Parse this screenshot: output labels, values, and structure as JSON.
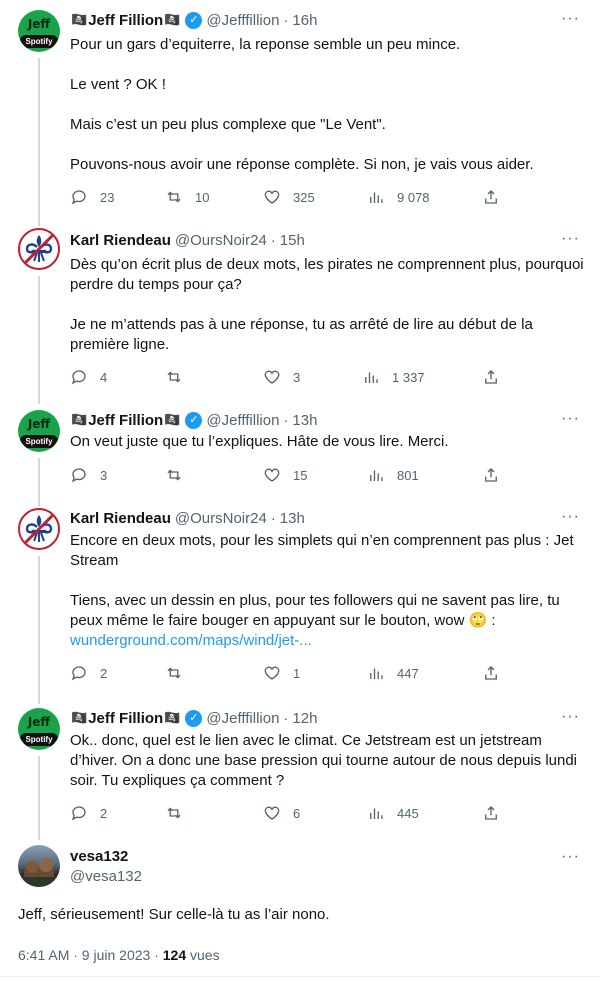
{
  "tweets": [
    {
      "author": "Jeff Fillion",
      "handle": "@Jefffillion",
      "time": "16h",
      "paragraphs": [
        "Pour un gars d’equiterre, la reponse semble un peu mince.",
        "Le vent ? OK !",
        "Mais c’est un peu plus complexe que \"Le Vent\".",
        "Pouvons-nous avoir une réponse complète. Si non, je vais vous aider."
      ],
      "replies": "23",
      "retweets": "10",
      "likes": "325",
      "views": "9 078"
    },
    {
      "author": "Karl Riendeau",
      "handle": "@OursNoir24",
      "time": "15h",
      "paragraphs": [
        "Dès qu’on écrit plus de deux mots, les pirates ne comprennent plus, pourquoi perdre du temps pour ça?",
        "Je ne m’attends pas à une réponse, tu as arrêté de lire au début de la première ligne."
      ],
      "replies": "4",
      "retweets": "",
      "likes": "3",
      "views": "1 337"
    },
    {
      "author": "Jeff Fillion",
      "handle": "@Jefffillion",
      "time": "13h",
      "paragraphs": [
        "On veut juste que tu l’expliques. Hâte de vous lire. Merci."
      ],
      "replies": "3",
      "retweets": "",
      "likes": "15",
      "views": "801"
    },
    {
      "author": "Karl Riendeau",
      "handle": "@OursNoir24",
      "time": "13h",
      "paragraphs": [
        "Encore en deux mots, pour les simplets qui n’en comprennent pas plus : Jet Stream",
        "Tiens, avec un dessin en plus, pour tes followers qui ne savent pas lire, tu peux même le faire bouger en appuyant sur le bouton, wow 🙄 :"
      ],
      "link": "wunderground.com/maps/wind/jet-...",
      "replies": "2",
      "retweets": "",
      "likes": "1",
      "views": "447"
    },
    {
      "author": "Jeff Fillion",
      "handle": "@Jefffillion",
      "time": "12h",
      "paragraphs": [
        "Ok.. donc, quel est le lien avec le climat. Ce Jetstream est un jetstream d’hiver. On a donc une base pression qui tourne autour de nous depuis lundi soir. Tu expliques ça comment ?"
      ],
      "replies": "2",
      "retweets": "",
      "likes": "6",
      "views": "445"
    }
  ],
  "main_tweet": {
    "author": "vesa132",
    "handle": "@vesa132",
    "text": "Jeff, sérieusement! Sur celle-là tu as l’air nono.",
    "date": "6:41 AM · 9 juin 2023 · ",
    "views_count": "124",
    "views_label": " vues"
  },
  "common": {
    "more": "···",
    "skull": "🏴‍☠️",
    "jeff_avatar_text": "Jeff",
    "jeff_avatar_badge": "Spotify",
    "verified_mark": "✓"
  },
  "icons": [
    "reply-icon",
    "retweet-icon",
    "like-icon",
    "views-icon",
    "share-icon",
    "verified-icon",
    "more-icon"
  ],
  "colors": {
    "accent": "#1d9bf0",
    "muted": "#536471",
    "text": "#0f1419",
    "line": "#cfd9de"
  }
}
